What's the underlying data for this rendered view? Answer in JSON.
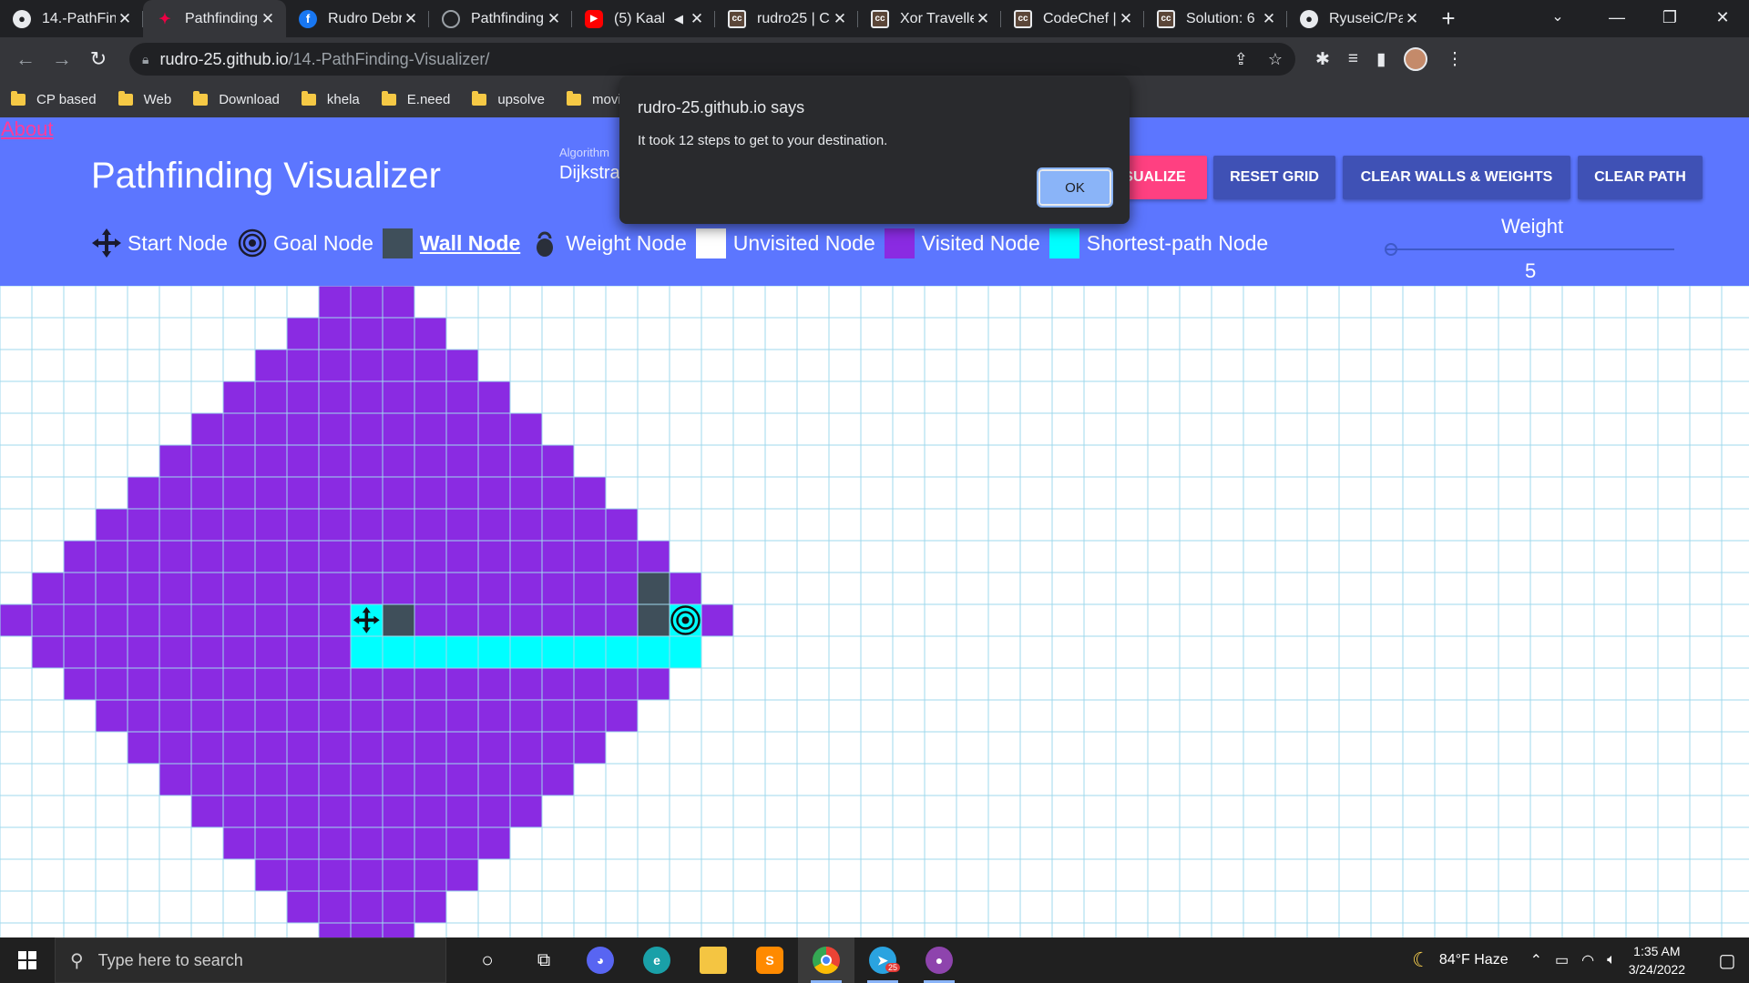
{
  "browser": {
    "tabs": [
      {
        "icon": "github-icon",
        "title": "14.-PathFin",
        "active": false
      },
      {
        "icon": "pathfinding-icon",
        "title": "Pathfinding",
        "active": true
      },
      {
        "icon": "facebook-icon",
        "title": "Rudro Debr",
        "active": false
      },
      {
        "icon": "globe-icon",
        "title": "Pathfinding",
        "active": false
      },
      {
        "icon": "youtube-icon",
        "title": "(5) Kaal",
        "active": false
      },
      {
        "icon": "codechef-icon",
        "title": "rudro25 | C",
        "active": false
      },
      {
        "icon": "codechef-icon",
        "title": "Xor Travelle",
        "active": false
      },
      {
        "icon": "codechef-icon",
        "title": "CodeChef |",
        "active": false
      },
      {
        "icon": "codechef-icon",
        "title": "Solution: 6",
        "active": false
      },
      {
        "icon": "github-icon",
        "title": "RyuseiC/Pa",
        "active": false
      }
    ],
    "url_host": "rudro-25.github.io",
    "url_path": "/14.-PathFinding-Visualizer/",
    "bookmarks": [
      "CP based",
      "Web",
      "Download",
      "khela",
      "E.need",
      "upsolve",
      "movie"
    ]
  },
  "page": {
    "about_link": "About",
    "brand": "Pathfinding Visualizer",
    "algorithm_label": "Algorithm",
    "algorithm_value": "Dijkstra",
    "buttons": {
      "visualize": "SUALIZE",
      "reset_grid": "RESET GRID",
      "clear_walls_weights": "CLEAR WALLS & WEIGHTS",
      "clear_path": "CLEAR PATH"
    },
    "legend": {
      "start": "Start Node",
      "goal": "Goal Node",
      "wall": "Wall Node",
      "weight": "Weight Node",
      "unvisited": "Unvisited Node",
      "visited": "Visited Node",
      "shortest": "Shortest-path Node"
    },
    "weight_label": "Weight",
    "weight_value": "5",
    "colors": {
      "navbar": "#5c76ff",
      "visited": "#8a2be2",
      "shortest": "#00ffff",
      "wall": "#3f4f5a",
      "gridline": "#9fd8ec"
    }
  },
  "dialog": {
    "title": "rudro-25.github.io says",
    "message": "It took 12 steps to get to your destination.",
    "ok_label": "OK"
  },
  "taskbar": {
    "search_placeholder": "Type here to search",
    "weather": "84°F  Haze",
    "time": "1:35 AM",
    "date": "3/24/2022",
    "telegram_badge": "25"
  }
}
